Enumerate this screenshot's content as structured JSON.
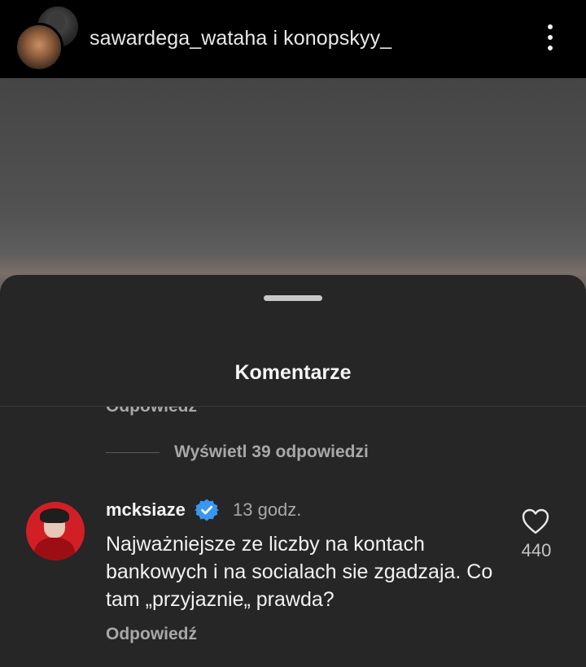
{
  "header": {
    "account_names": "sawardega_wataha i konopskyy_",
    "more_icon": "more-vertical-icon"
  },
  "comments_sheet": {
    "title": "Komentarze",
    "cut_off_reply_label": "Odpowiedź",
    "view_replies_label": "Wyświetl 39 odpowiedzi",
    "comment": {
      "username": "mcksiaze",
      "verified": true,
      "timestamp": "13 godz.",
      "text": "Najważniejsze ze liczby na kontach bankowych i na socialach sie zgadzaja. Co tam „przyjaznie„ prawda?",
      "reply_label": "Odpowiedź",
      "like_count": "440"
    }
  },
  "colors": {
    "background": "#000000",
    "sheet": "#262626",
    "secondary_text": "#a8a8a8",
    "verified_badge": "#3897f0",
    "avatar_ring": "#d21f26"
  }
}
